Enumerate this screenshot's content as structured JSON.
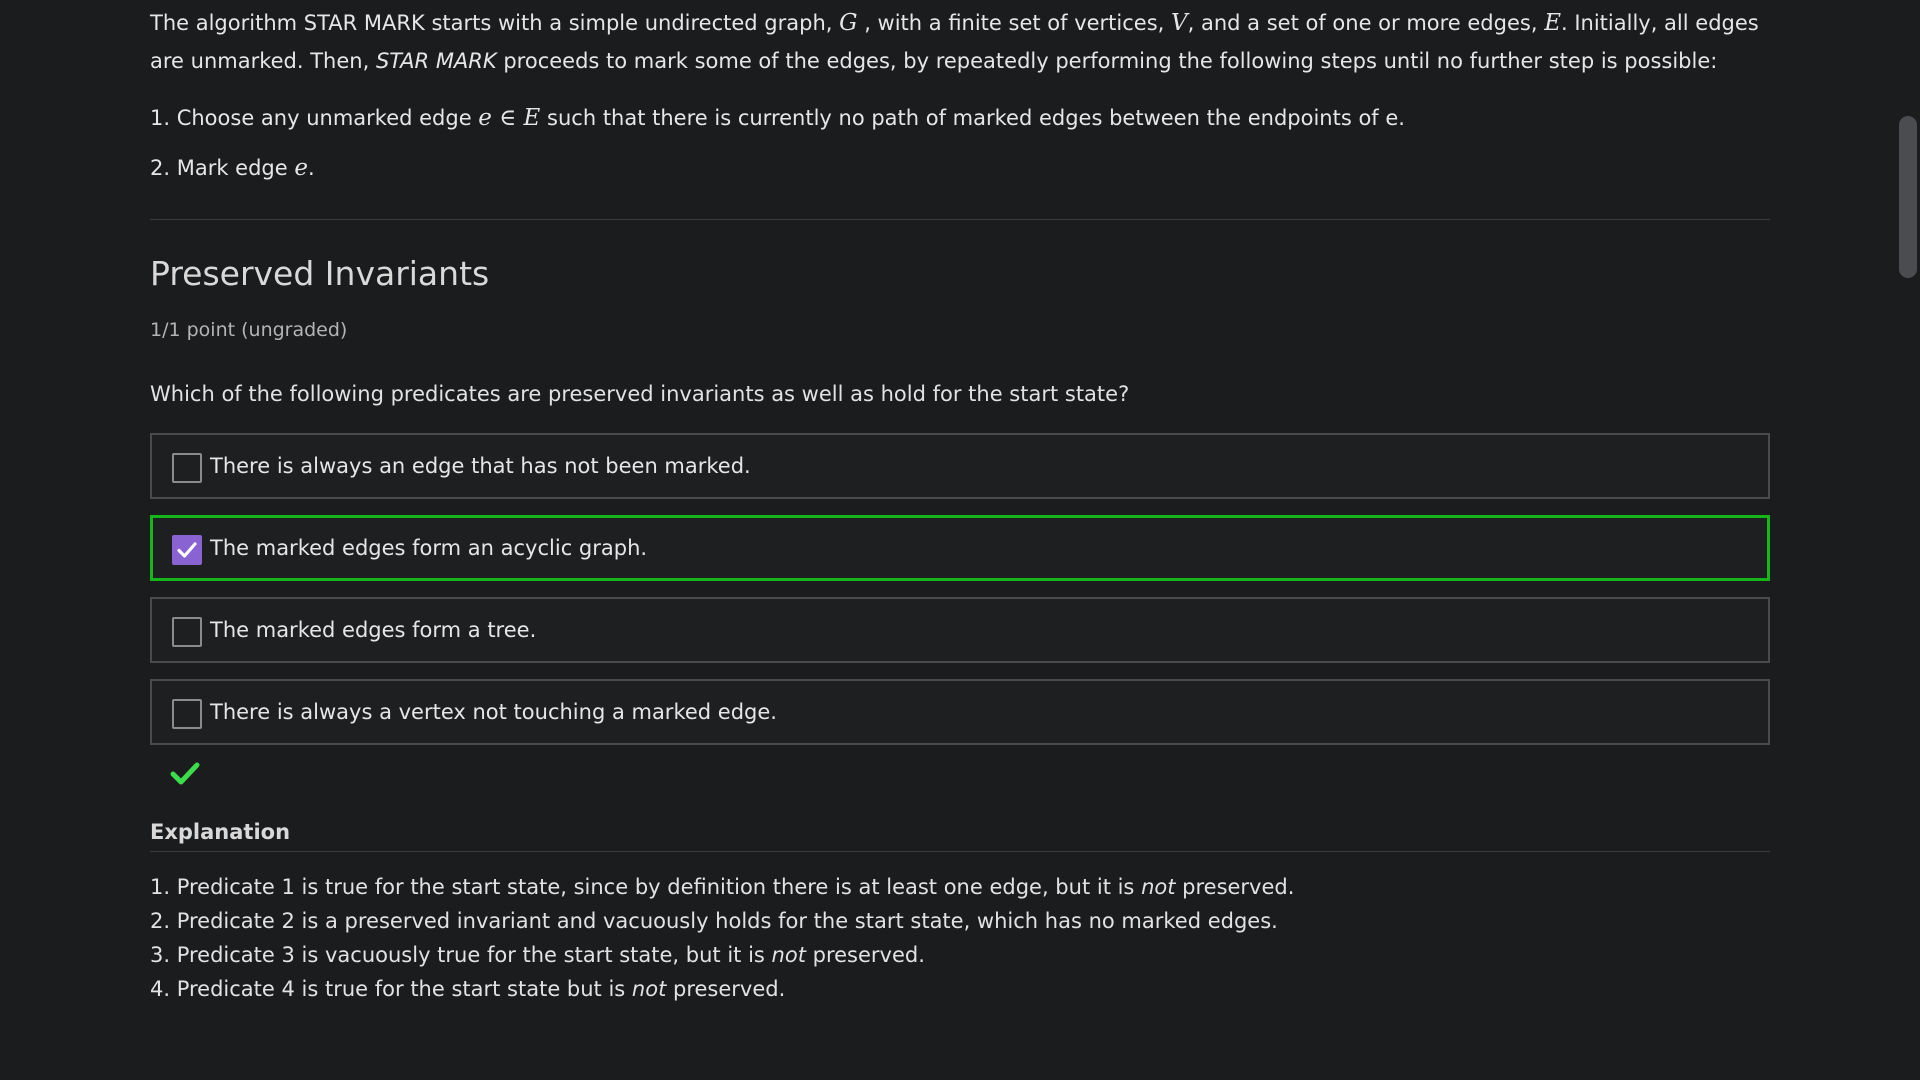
{
  "intro": {
    "p1": "The algorithm STAR MARK starts with a simple undirected graph, ",
    "g": "G",
    "p2": " , with a finite set of vertices, ",
    "v": "V",
    "p3": ", and a set of one or more edges, ",
    "e": "E",
    "p4": ". Initially, all edges are unmarked. Then, ",
    "algo_italic": "STAR MARK",
    "p5": " proceeds to mark some of the edges, by repeatedly performing the following steps until no further step is possible:"
  },
  "steps": [
    {
      "pre": "1. Choose any unmarked edge ",
      "math": "e ∈ E",
      "post": " such that there is currently no path of marked edges between the endpoints of e."
    },
    {
      "pre": "2. Mark edge ",
      "math": "e",
      "post": "."
    }
  ],
  "problem": {
    "title": "Preserved Invariants",
    "points": "1/1 point (ungraded)",
    "question": "Which of the following predicates are preserved invariants as well as hold for the start state?",
    "choices": [
      {
        "label": "There is always an edge that has not been marked.",
        "checked": false
      },
      {
        "label": "The marked edges form an acyclic graph.",
        "checked": true
      },
      {
        "label": "The marked edges form a tree.",
        "checked": false
      },
      {
        "label": "There is always a vertex not touching a marked edge.",
        "checked": false
      }
    ],
    "status_icon": "correct-check-icon",
    "status_color": "#3ddc4a"
  },
  "explanation": {
    "title": "Explanation",
    "items": [
      {
        "pre": "1. Predicate 1 is true for the start state, since by definition there is at least one edge, but it is ",
        "em": "not",
        "post": " preserved."
      },
      {
        "pre": "2. Predicate 2 is a preserved invariant and vacuously holds for the start state, which has no marked edges.",
        "em": "",
        "post": ""
      },
      {
        "pre": "3. Predicate 3 is vacuously true for the start state, but it is ",
        "em": "not",
        "post": " preserved."
      },
      {
        "pre": "4. Predicate 4 is true for the start state but is ",
        "em": "not",
        "post": " preserved."
      }
    ]
  },
  "colors": {
    "background": "#1b1c1e",
    "selected_border": "#16b51a",
    "checkbox_checked": "#8a63d2",
    "correct": "#3ddc4a"
  }
}
